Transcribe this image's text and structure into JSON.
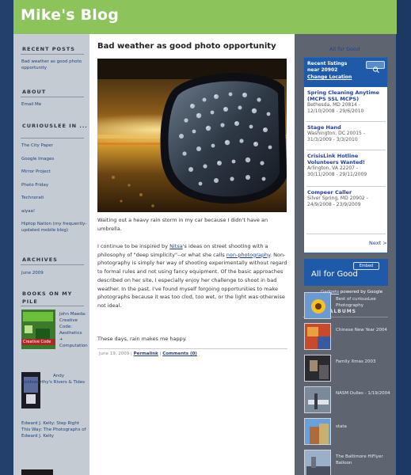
{
  "header": {
    "title": "Mike's Blog"
  },
  "left": {
    "recent_posts": {
      "heading": "RECENT POSTS",
      "items": [
        "Bad weather as good photo opportunity"
      ]
    },
    "about": {
      "heading": "ABOUT",
      "items": [
        "Email Me"
      ]
    },
    "curiouslee": {
      "heading": "CURIOUSLEE IN ...",
      "items": [
        "The City Paper",
        "Google Images",
        "Mirror Project",
        "Photo Friday",
        "Technorati",
        "aiyaa!",
        "Hiptop Nation (my frequently-updated mobile blog)"
      ]
    },
    "archives": {
      "heading": "ARCHIVES",
      "items": [
        "June 2009"
      ]
    },
    "books": {
      "heading": "BOOKS ON MY PILE",
      "book1_cover": "Creative Code",
      "book1": "John Maeda: Creative Code: Aesthetics + Computation",
      "book2": "Andy Goldsworthy's Rivers & Tides",
      "book3": "Edward J. Kelty: Step Right This Way: The Photographs of Edward J. Kelty"
    }
  },
  "post": {
    "title": "Bad weather as good photo opportunity",
    "p1": "Waiting out a heavy rain storm in my car because I didn't have an umbrella.",
    "p2_a": "I continue to be inspired by ",
    "p2_link1": "Nitsa",
    "p2_b": "'s ideas on street shooting with a philosophy of \"deep simplicity\"--or what she calls ",
    "p2_link2": "non-photography",
    "p2_c": ". Non-photography is simply her way of shooting experimentally without regard to formal rules and not using fancy equipment. Of the basic approaches described on her site, I especially enjoy her challenge to shoot in bad weather. In the past, I've found myself forgoing opportunities to make photographs because it was too clod, too wet, or the light was otherwise not ideal.",
    "p3": "These days, rain makes me happy.",
    "date": "June 19, 2009",
    "sep": "|",
    "permalink": "Permalink",
    "comments": "Comments (0)"
  },
  "widget": {
    "title": "All for Good",
    "recent_line1": "Recent listings",
    "recent_line2": "near 20902",
    "change_location": "Change Location",
    "listings": [
      {
        "title": "Spring Cleaning Anytime (MCPS SSL MCPS)",
        "detail": "Bethesda, MD 20814 - 12/10/2008 - 29/6/2010"
      },
      {
        "title": "Stage Hand",
        "detail": "Washington, DC 20015 - 31/3/2009 - 3/3/2010"
      },
      {
        "title": "CrisisLink Hotline Volunteers Wanted!",
        "detail": "Arlington, VA 22207 - 30/11/2008 - 29/11/2009"
      },
      {
        "title": "Compeer Caller",
        "detail": "Silver Spring, MD 20902 - 24/9/2008 - 23/9/2009"
      }
    ],
    "next": "Next >",
    "embed": "Embed",
    "banner": "All for Good",
    "gadgets_link": "Gadgets",
    "gadgets_rest": " powered by Google"
  },
  "albums": {
    "heading": "PHOTO ALBUMS",
    "items": [
      "Best of curiousLee Photography",
      "Chinese New Year 2004",
      "Family Xmas 2003",
      "NASM Dulles - 1/19/2004",
      "stata",
      "The Baltimore HiFlyer Balloon"
    ]
  },
  "colors": {
    "header": "#8cc35a",
    "frame": "#203e70",
    "left_bg": "#c5cbd3",
    "right_bg": "#5e6570",
    "link": "#1f3f7a",
    "widget_blue": "#1f5aa8"
  }
}
